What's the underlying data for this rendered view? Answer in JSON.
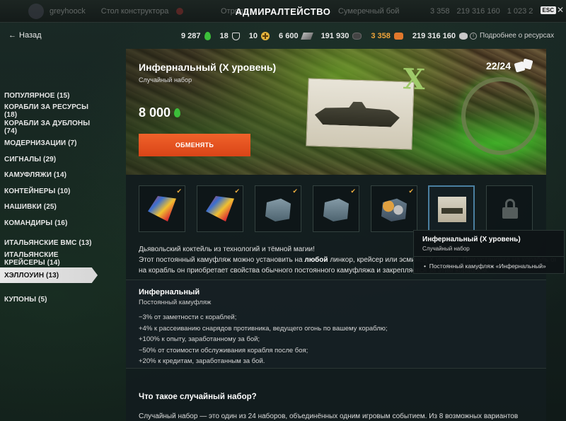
{
  "header": {
    "title": "АДМИРАЛТЕЙСТВО",
    "username": "greyhoock",
    "constructor_label": "Стол конструктора",
    "tab_left": "Отряды",
    "tab_right": "Сумеречный бой",
    "top_resources": [
      "3 358",
      "219 316 160",
      "1 023 2"
    ],
    "esc_label": "ESC"
  },
  "nav": {
    "back_label": "Назад",
    "more_resources": "Подробнее о ресурсах"
  },
  "resources": [
    {
      "value": "9 287",
      "icon": "green-drop-icon"
    },
    {
      "value": "18",
      "icon": "shield-icon"
    },
    {
      "value": "10",
      "icon": "gold-plus-icon"
    },
    {
      "value": "6 600",
      "icon": "steel-icon"
    },
    {
      "value": "191 930",
      "icon": "coal-icon"
    },
    {
      "value": "3 358",
      "icon": "doubloon-icon",
      "color": "#f0a43a"
    },
    {
      "value": "219 316 160",
      "icon": "credits-icon"
    }
  ],
  "sidebar": {
    "items": [
      {
        "label": "ПОПУЛЯРНОЕ (15)"
      },
      {
        "label": "КОРАБЛИ ЗА РЕСУРСЫ (18)"
      },
      {
        "label": "КОРАБЛИ ЗА ДУБЛОНЫ (74)"
      },
      {
        "label": "МОДЕРНИЗАЦИИ (7)"
      },
      {
        "label": "СИГНАЛЫ (29)"
      },
      {
        "label": "КАМУФЛЯЖИ (14)"
      },
      {
        "label": "КОНТЕЙНЕРЫ (10)"
      },
      {
        "label": "НАШИВКИ (25)"
      },
      {
        "label": "КОМАНДИРЫ (16)"
      },
      {
        "label": "ИТАЛЬЯНСКИЕ ВМС (13)"
      },
      {
        "label": "ИТАЛЬЯНСКИЕ КРЕЙСЕРЫ (14)"
      },
      {
        "label": "ХЭЛЛОУИН (13)",
        "active": true
      },
      {
        "label": "КУПОНЫ (5)"
      }
    ]
  },
  "banner": {
    "title": "Инфернальный (X уровень)",
    "subtitle": "Случайный набор",
    "price": "8 000",
    "exchange_label": "ОБМЕНЯТЬ",
    "counter": "22/24",
    "card_mark": "X"
  },
  "thumbnails": [
    {
      "art": "flags",
      "checked": true
    },
    {
      "art": "flags",
      "checked": true
    },
    {
      "art": "crate",
      "checked": true
    },
    {
      "art": "crate",
      "checked": true
    },
    {
      "art": "stars",
      "checked": true
    },
    {
      "art": "camo",
      "checked": false,
      "selected": true
    },
    {
      "art": "lock",
      "checked": false
    }
  ],
  "tooltip": {
    "title": "Инфернальный (X уровень)",
    "subtitle": "Случайный набор",
    "item": "Постоянный камуфляж «Инфернальный»"
  },
  "description": {
    "line1": "Дьявольский коктейль из технологий и тёмной магии!",
    "line2_pre": "Этот постоянный камуфляж можно установить на ",
    "line2_bold": "любой",
    "line2_post": " линкор, крейсер или эсминец Х уровня. При установке на корабль он приобретает свойства",
    "line3": "на корабль он приобретает свойства обычного постоянного камуфляжа и закрепляется за этим кораблём."
  },
  "details": {
    "title": "Инфернальный",
    "subtitle": "Постоянный камуфляж",
    "bonuses": [
      "−3% от заметности с кораблей;",
      "+4% к рассеиванию снарядов противника, ведущего огонь по вашему кораблю;",
      "+100% к опыту, заработанному за бой;",
      "−50% от стоимости обслуживания корабля после боя;",
      "+20% к кредитам, заработанным за бой."
    ]
  },
  "faq": {
    "question": "Что такое случайный набор?",
    "answer": "Случайный набор — это один из 24 наборов, объединённых одним игровым событием. Из 8 возможных вариантов"
  }
}
